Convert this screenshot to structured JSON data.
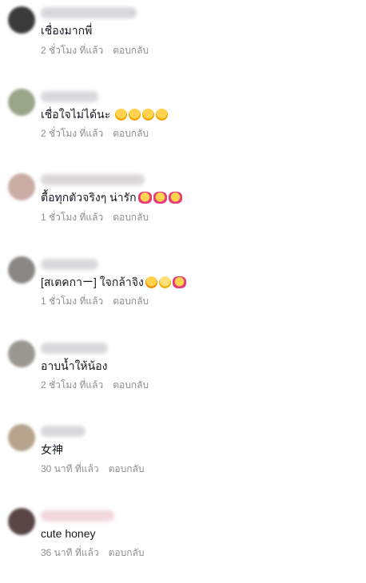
{
  "comments": [
    {
      "text": "เชื่องมากพี่",
      "time": "2 ชั่วโมง ที่แล้ว",
      "reply": "ตอบกลับ",
      "emojis": []
    },
    {
      "text": "เชื่อใจไม่ได้นะ",
      "time": "2 ชั่วโมง ที่แล้ว",
      "reply": "ตอบกลับ",
      "emojis": [
        "laughing-emoji",
        "laughing-emoji",
        "laughing-emoji",
        "laughing-emoji"
      ]
    },
    {
      "text": "ตื้อทุกตัวจริงๆ น่ารัก",
      "time": "1 ชั่วโมง ที่แล้ว",
      "reply": "ตอบกลับ",
      "emojis": [
        "hearts-face-emoji",
        "hearts-face-emoji",
        "hearts-face-emoji"
      ]
    },
    {
      "text": "[สเตคกาー] ใจกล้าจิง",
      "time": "1 ชั่วโมง ที่แล้ว",
      "reply": "ตอบกลับ",
      "emojis": [
        "rofl-emoji",
        "grin-emoji",
        "hearts-face-emoji"
      ]
    },
    {
      "text": "อาบน้ำให้น้อง",
      "time": "2 ชั่วโมง ที่แล้ว",
      "reply": "ตอบกลับ",
      "emojis": []
    },
    {
      "text": "女神",
      "time": "30 นาที ที่แล้ว",
      "reply": "ตอบกลับ",
      "emojis": []
    },
    {
      "text": "cute honey",
      "time": "36 นาที ที่แล้ว",
      "reply": "ตอบกลับ",
      "emojis": []
    }
  ]
}
